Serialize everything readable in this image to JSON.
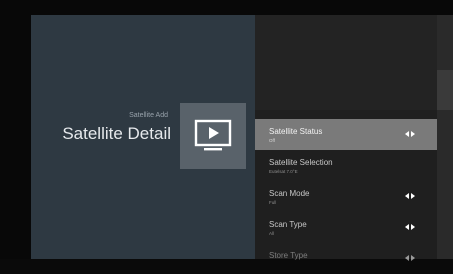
{
  "header": {
    "breadcrumb": "Satellite Add",
    "title": "Satellite Detail"
  },
  "menu": {
    "items": [
      {
        "label": "Satellite Status",
        "value": "Off",
        "has_arrows": true,
        "selected": true
      },
      {
        "label": "Satellite Selection",
        "value": "Eutelsat 7.0°E",
        "has_arrows": false,
        "selected": false
      },
      {
        "label": "Scan Mode",
        "value": "Full",
        "has_arrows": true,
        "selected": false
      },
      {
        "label": "Scan Type",
        "value": "All",
        "has_arrows": true,
        "selected": false
      },
      {
        "label": "Store Type",
        "value": "",
        "has_arrows": true,
        "selected": false
      }
    ]
  },
  "icons": {
    "card": "tv-play-icon",
    "arrows": "left-right-arrows-icon"
  },
  "colors": {
    "left_panel": "#2e3942",
    "right_panel": "#1f1f1f",
    "selected_row": "#7a7a7a",
    "card": "#59626a"
  }
}
